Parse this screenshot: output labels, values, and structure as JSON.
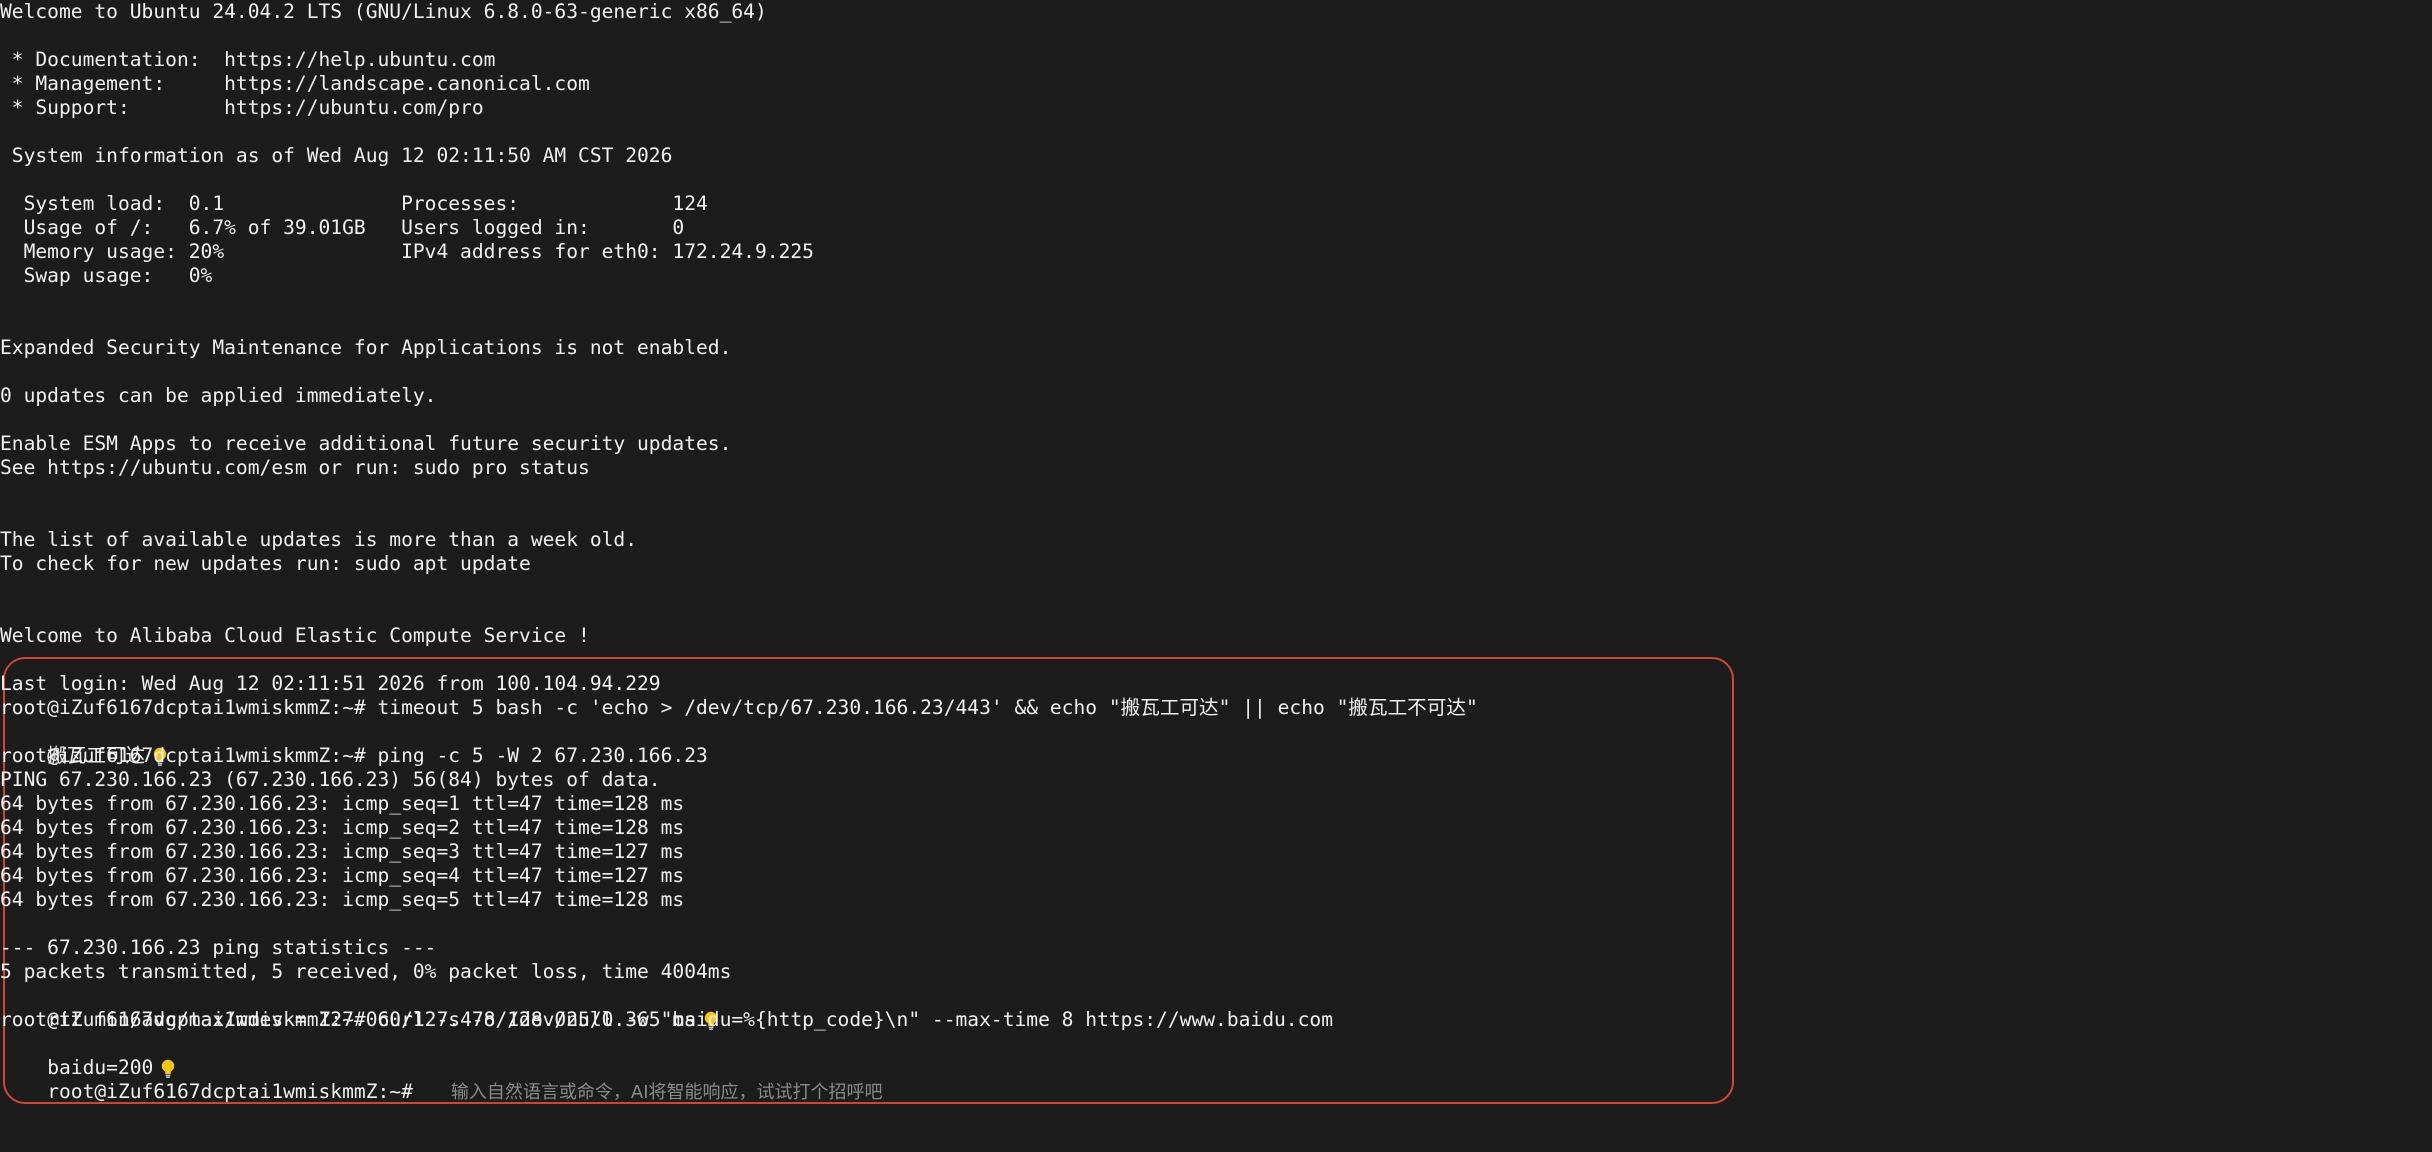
{
  "terminal": {
    "motd": {
      "welcome": "Welcome to Ubuntu 24.04.2 LTS (GNU/Linux 6.8.0-63-generic x86_64)",
      "doc": " * Documentation:  https://help.ubuntu.com",
      "mgmt": " * Management:     https://landscape.canonical.com",
      "support": " * Support:        https://ubuntu.com/pro",
      "sysinfo": " System information as of Wed Aug 12 02:11:50 AM CST 2026",
      "row1": "  System load:  0.1               Processes:             124",
      "row2": "  Usage of /:   6.7% of 39.01GB   Users logged in:       0",
      "row3": "  Memory usage: 20%               IPv4 address for eth0: 172.24.9.225",
      "row4": "  Swap usage:   0%",
      "esm": "Expanded Security Maintenance for Applications is not enabled.",
      "updates": "0 updates can be applied immediately.",
      "enable_esm": "Enable ESM Apps to receive additional future security updates.",
      "see_esm": "See https://ubuntu.com/esm or run: sudo pro status",
      "list_old": "The list of available updates is more than a week old.",
      "check_updates": "To check for new updates run: sudo apt update",
      "alibaba": "Welcome to Alibaba Cloud Elastic Compute Service !"
    },
    "session": {
      "last_login": "Last login: Wed Aug 12 02:11:51 2026 from 100.104.94.229",
      "cmd1": "root@iZuf6167dcptai1wmiskmmZ:~# timeout 5 bash -c 'echo > /dev/tcp/67.230.166.23/443' && echo \"搬瓦工可达\" || echo \"搬瓦工不可达\"",
      "out1": "搬瓦工可达",
      "cmd2": "root@iZuf6167dcptai1wmiskmmZ:~# ping -c 5 -W 2 67.230.166.23",
      "ping_header": "PING 67.230.166.23 (67.230.166.23) 56(84) bytes of data.",
      "ping1": "64 bytes from 67.230.166.23: icmp_seq=1 ttl=47 time=128 ms",
      "ping2": "64 bytes from 67.230.166.23: icmp_seq=2 ttl=47 time=128 ms",
      "ping3": "64 bytes from 67.230.166.23: icmp_seq=3 ttl=47 time=127 ms",
      "ping4": "64 bytes from 67.230.166.23: icmp_seq=4 ttl=47 time=127 ms",
      "ping5": "64 bytes from 67.230.166.23: icmp_seq=5 ttl=47 time=128 ms",
      "stats_header": "--- 67.230.166.23 ping statistics ---",
      "stats_packets": "5 packets transmitted, 5 received, 0% packet loss, time 4004ms",
      "stats_rtt": "rtt min/avg/max/mdev = 127.060/127.478/128.025/0.365 ms",
      "cmd3": "root@iZuf6167dcptai1wmiskmmZ:~# curl -s -o /dev/null -w \"baidu=%{http_code}\\n\" --max-time 8 https://www.baidu.com",
      "out3": "baidu=200",
      "prompt": "root@iZuf6167dcptai1wmiskmmZ:~#",
      "input_placeholder": "输入自然语言或命令，AI将智能响应，试试打个招呼吧"
    },
    "colors": {
      "background": "#1c1c1c",
      "text": "#f0f0f0",
      "highlight_border": "#d2452f",
      "bulb": "#f5c518",
      "placeholder": "#8a8a8a"
    },
    "icons": {
      "hint": "lightbulb-icon"
    }
  }
}
